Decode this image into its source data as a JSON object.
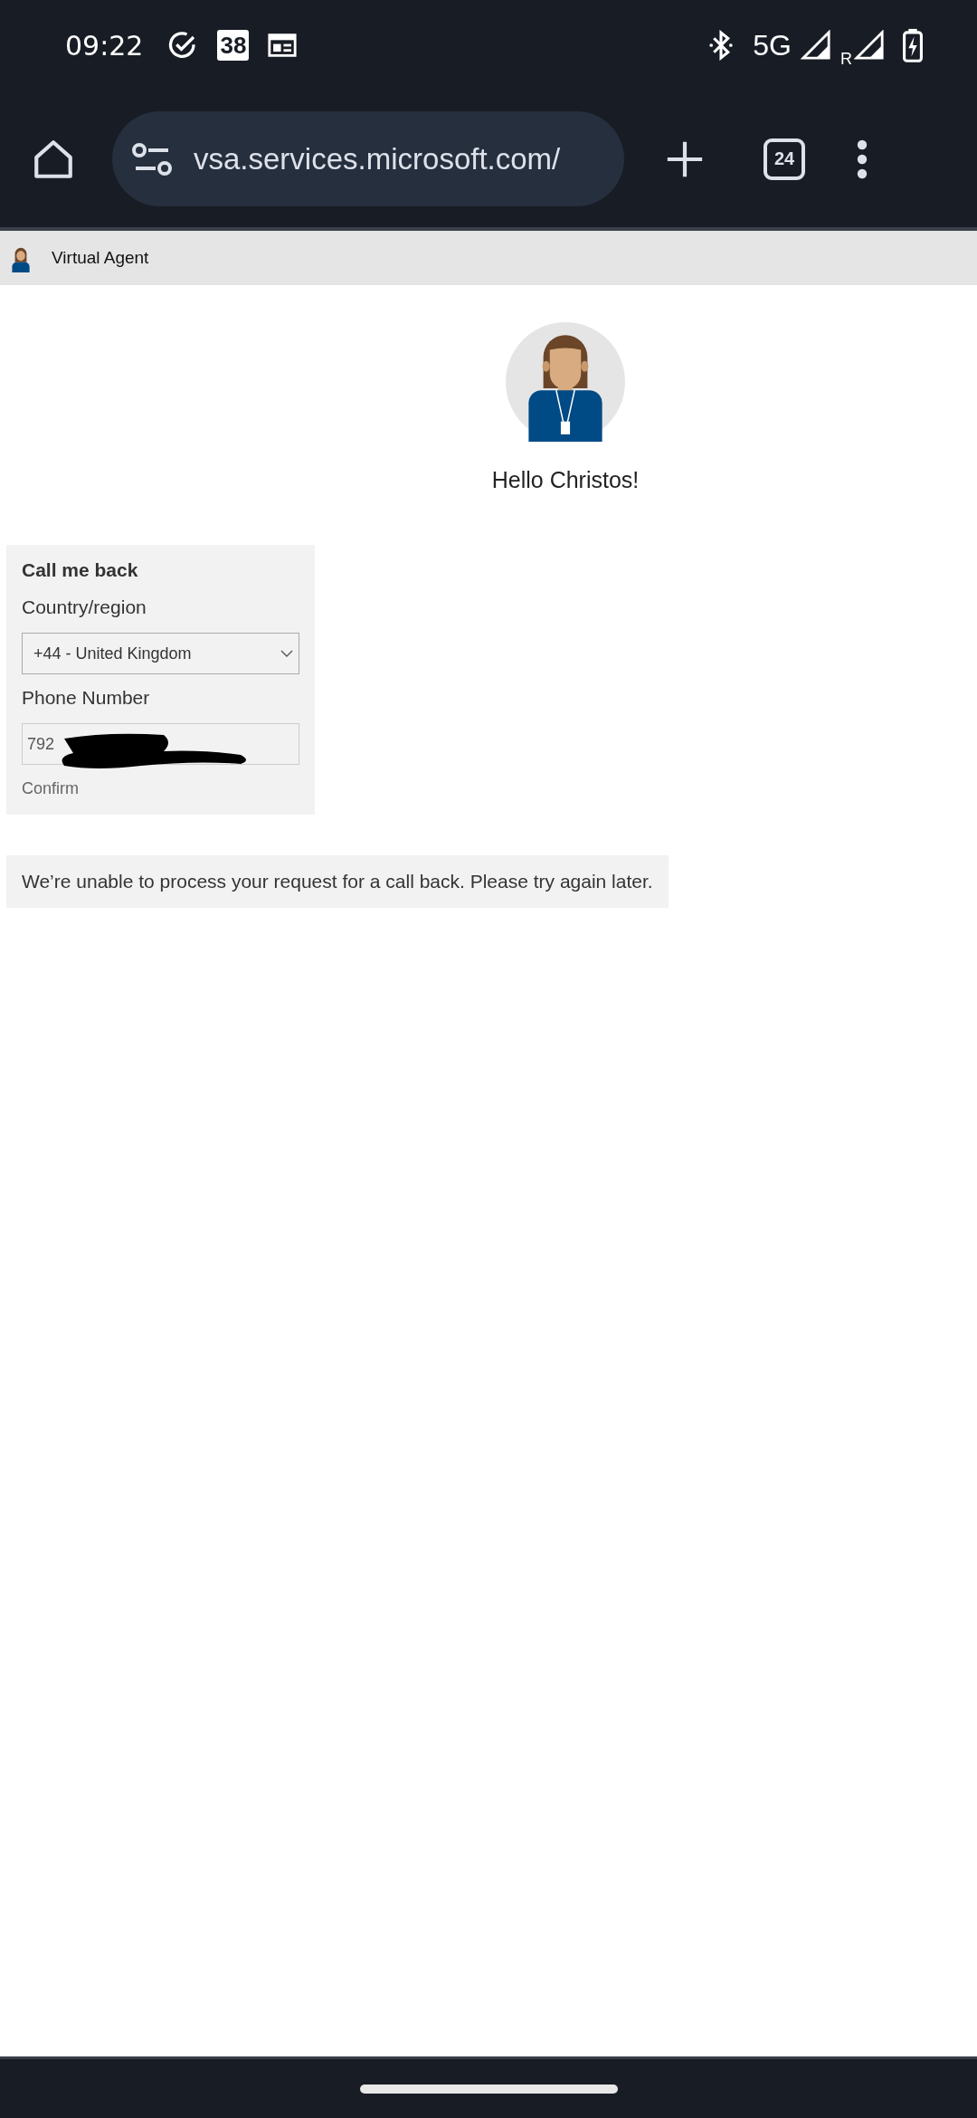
{
  "status_bar": {
    "time": "09:22",
    "calendar_badge": "38",
    "network": "5G",
    "roaming": "R"
  },
  "browser": {
    "url": "vsa.services.microsoft.com/",
    "tab_count": "24"
  },
  "page_header": {
    "title": "Virtual Agent"
  },
  "greeting": "Hello Christos!",
  "callback_form": {
    "title": "Call me back",
    "country_label": "Country/region",
    "country_value": "+44 - United Kingdom",
    "phone_label": "Phone Number",
    "phone_value": "792",
    "confirm": "Confirm"
  },
  "error_message": "We’re unable to process your request for a call back. Please try again later."
}
